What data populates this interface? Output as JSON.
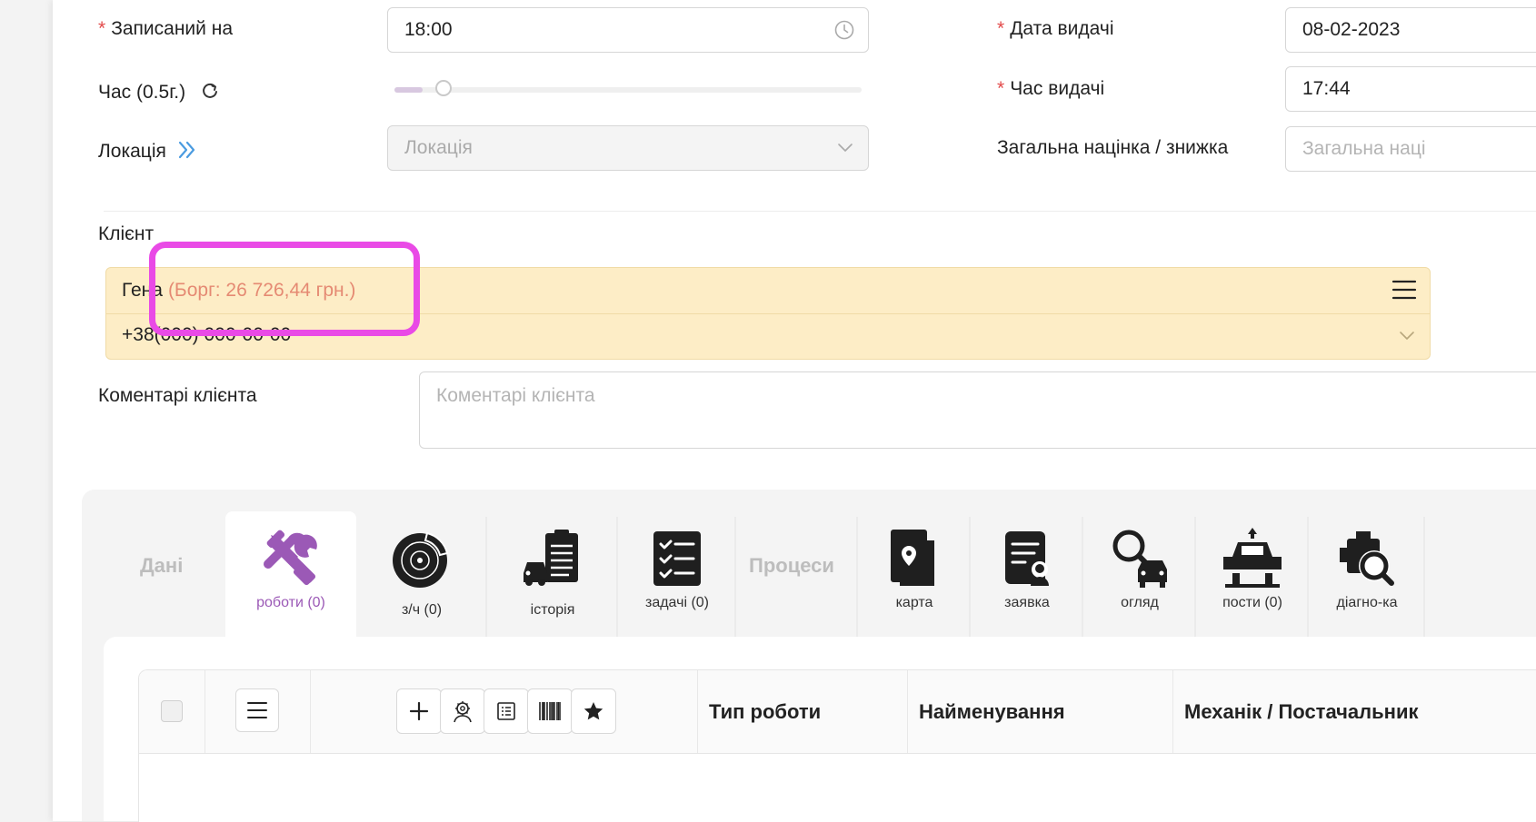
{
  "form": {
    "recorded_label": "Записаний на",
    "recorded_value": "18:00",
    "time_label": "Час (0.5г.)",
    "time_slider_level": 0.06,
    "location_label": "Локація",
    "location_placeholder": "Локація",
    "issue_date_label": "Дата видачі",
    "issue_date_value": "08-02-2023",
    "issue_time_label": "Час видачі",
    "issue_time_value": "17:44",
    "markup_label": "Загальна націнка / знижка",
    "markup_placeholder": "Загальна наці"
  },
  "client": {
    "label": "Клієнт",
    "name": "Гена",
    "debt": "(Борг: 26 726,44 грн.)",
    "phone": "+38(000) 000-00-00",
    "comments_label": "Коментарі клієнта",
    "comments_placeholder": "Коментарі клієнта"
  },
  "tabs": {
    "data_section": "Дані",
    "processes_section": "Процеси",
    "items": [
      {
        "label": "роботи (0)",
        "icon": "tools-icon"
      },
      {
        "label": "з/ч (0)",
        "icon": "brake-disc-icon"
      },
      {
        "label": "історія",
        "icon": "car-history-icon"
      },
      {
        "label": "задачі (0)",
        "icon": "checklist-icon"
      },
      {
        "label": "карта",
        "icon": "map-icon"
      },
      {
        "label": "заявка",
        "icon": "request-icon"
      },
      {
        "label": "огляд",
        "icon": "inspection-icon"
      },
      {
        "label": "пости (0)",
        "icon": "lift-icon"
      },
      {
        "label": "діагно-ка",
        "icon": "diagnostics-icon"
      }
    ]
  },
  "table": {
    "col_type": "Тип роботи",
    "col_name": "Найменування",
    "col_mechanic": "Механік / Постачальник"
  },
  "colors": {
    "accent": "#9b59b6",
    "client_bg": "#fdedc6",
    "debt": "#e58a73",
    "highlight": "#e94ae6",
    "required": "#e24a4a"
  }
}
